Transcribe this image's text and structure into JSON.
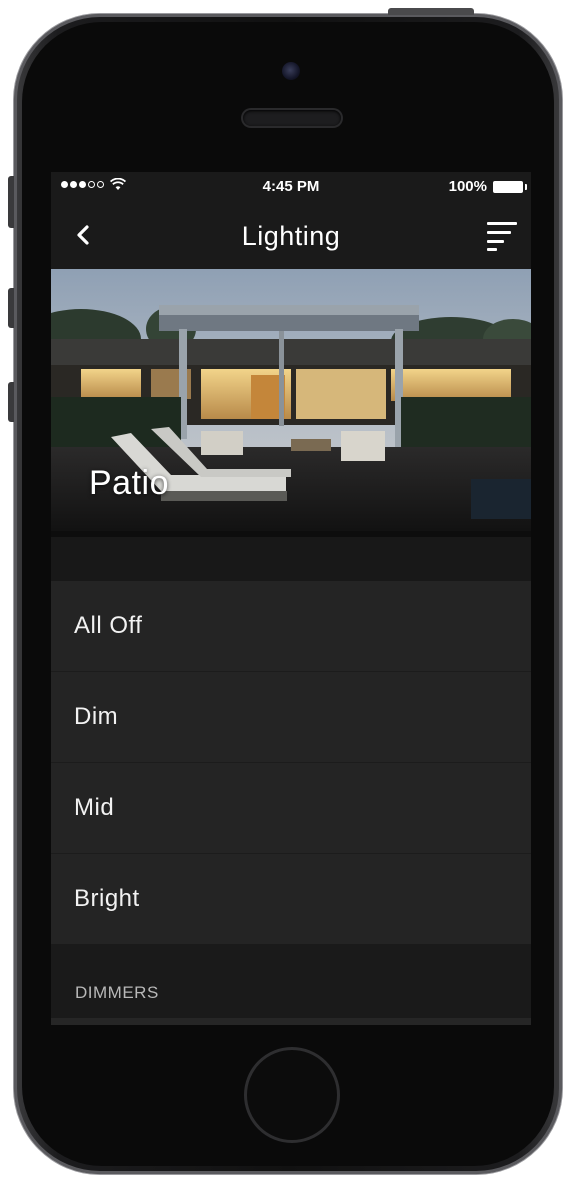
{
  "status_bar": {
    "time": "4:45 PM",
    "battery": "100%",
    "signal_dots_filled": 3,
    "signal_dots_total": 5
  },
  "nav": {
    "title": "Lighting",
    "back_icon": "chevron-left-icon",
    "menu_icon": "menu-icon"
  },
  "hero": {
    "room_name": "Patio"
  },
  "scenes": [
    {
      "label": "All Off"
    },
    {
      "label": "Dim"
    },
    {
      "label": "Mid"
    },
    {
      "label": "Bright"
    }
  ],
  "sections": {
    "dimmers_header": "DIMMERS"
  },
  "colors": {
    "screen_bg": "#1e1e1e",
    "list_bg": "#242424",
    "header_bg": "#1a1a1a",
    "text": "#f2f2f2",
    "section_text": "#b8b8b8"
  }
}
